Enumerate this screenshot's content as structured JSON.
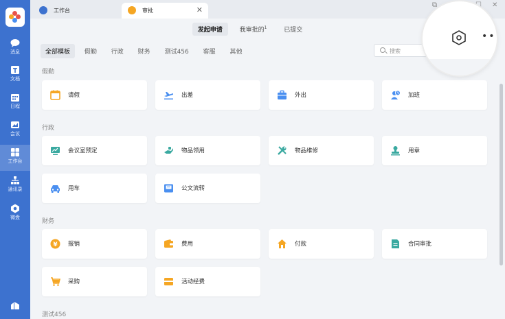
{
  "colors": {
    "sidebar": "#3d72cf",
    "orange": "#f5a623",
    "teal": "#3aa9a0",
    "blue": "#4a8ff0"
  },
  "sidebar": {
    "items": [
      {
        "label": "消息",
        "icon": "chat-icon"
      },
      {
        "label": "文档",
        "icon": "doc-icon"
      },
      {
        "label": "日程",
        "icon": "calendar-icon"
      },
      {
        "label": "会议",
        "icon": "meeting-icon"
      },
      {
        "label": "工作台",
        "icon": "grid-icon"
      },
      {
        "label": "通讯录",
        "icon": "org-icon"
      },
      {
        "label": "微盘",
        "icon": "disk-icon"
      }
    ]
  },
  "tabs": [
    {
      "label": "工作台",
      "icon": "workbench-icon"
    },
    {
      "label": "审批",
      "icon": "approval-icon"
    }
  ],
  "top_tabs": [
    {
      "label": "发起申请"
    },
    {
      "label": "我审批的",
      "badge": "1"
    },
    {
      "label": "已提交"
    }
  ],
  "filters": [
    "全部模板",
    "假勤",
    "行政",
    "财务",
    "测试456",
    "客服",
    "其他"
  ],
  "search": {
    "placeholder": "搜索"
  },
  "sections": [
    {
      "title": "假勤",
      "items": [
        {
          "label": "请假",
          "icon": "calendar-icon"
        },
        {
          "label": "出差",
          "icon": "plane-icon"
        },
        {
          "label": "外出",
          "icon": "briefcase-icon"
        },
        {
          "label": "加班",
          "icon": "overtime-icon"
        }
      ]
    },
    {
      "title": "行政",
      "items": [
        {
          "label": "会议室预定",
          "icon": "screen-icon"
        },
        {
          "label": "物品领用",
          "icon": "hand-icon"
        },
        {
          "label": "物品维修",
          "icon": "tools-icon"
        },
        {
          "label": "用章",
          "icon": "stamp-icon"
        },
        {
          "label": "用车",
          "icon": "car-icon"
        },
        {
          "label": "公文流转",
          "icon": "inbox-icon"
        }
      ]
    },
    {
      "title": "财务",
      "items": [
        {
          "label": "报销",
          "icon": "yen-icon"
        },
        {
          "label": "费用",
          "icon": "wallet-icon"
        },
        {
          "label": "付款",
          "icon": "house-icon"
        },
        {
          "label": "合同审批",
          "icon": "contract-icon"
        },
        {
          "label": "采购",
          "icon": "cart-icon"
        },
        {
          "label": "活动经费",
          "icon": "fund-icon"
        }
      ]
    },
    {
      "title": "测试456"
    }
  ]
}
